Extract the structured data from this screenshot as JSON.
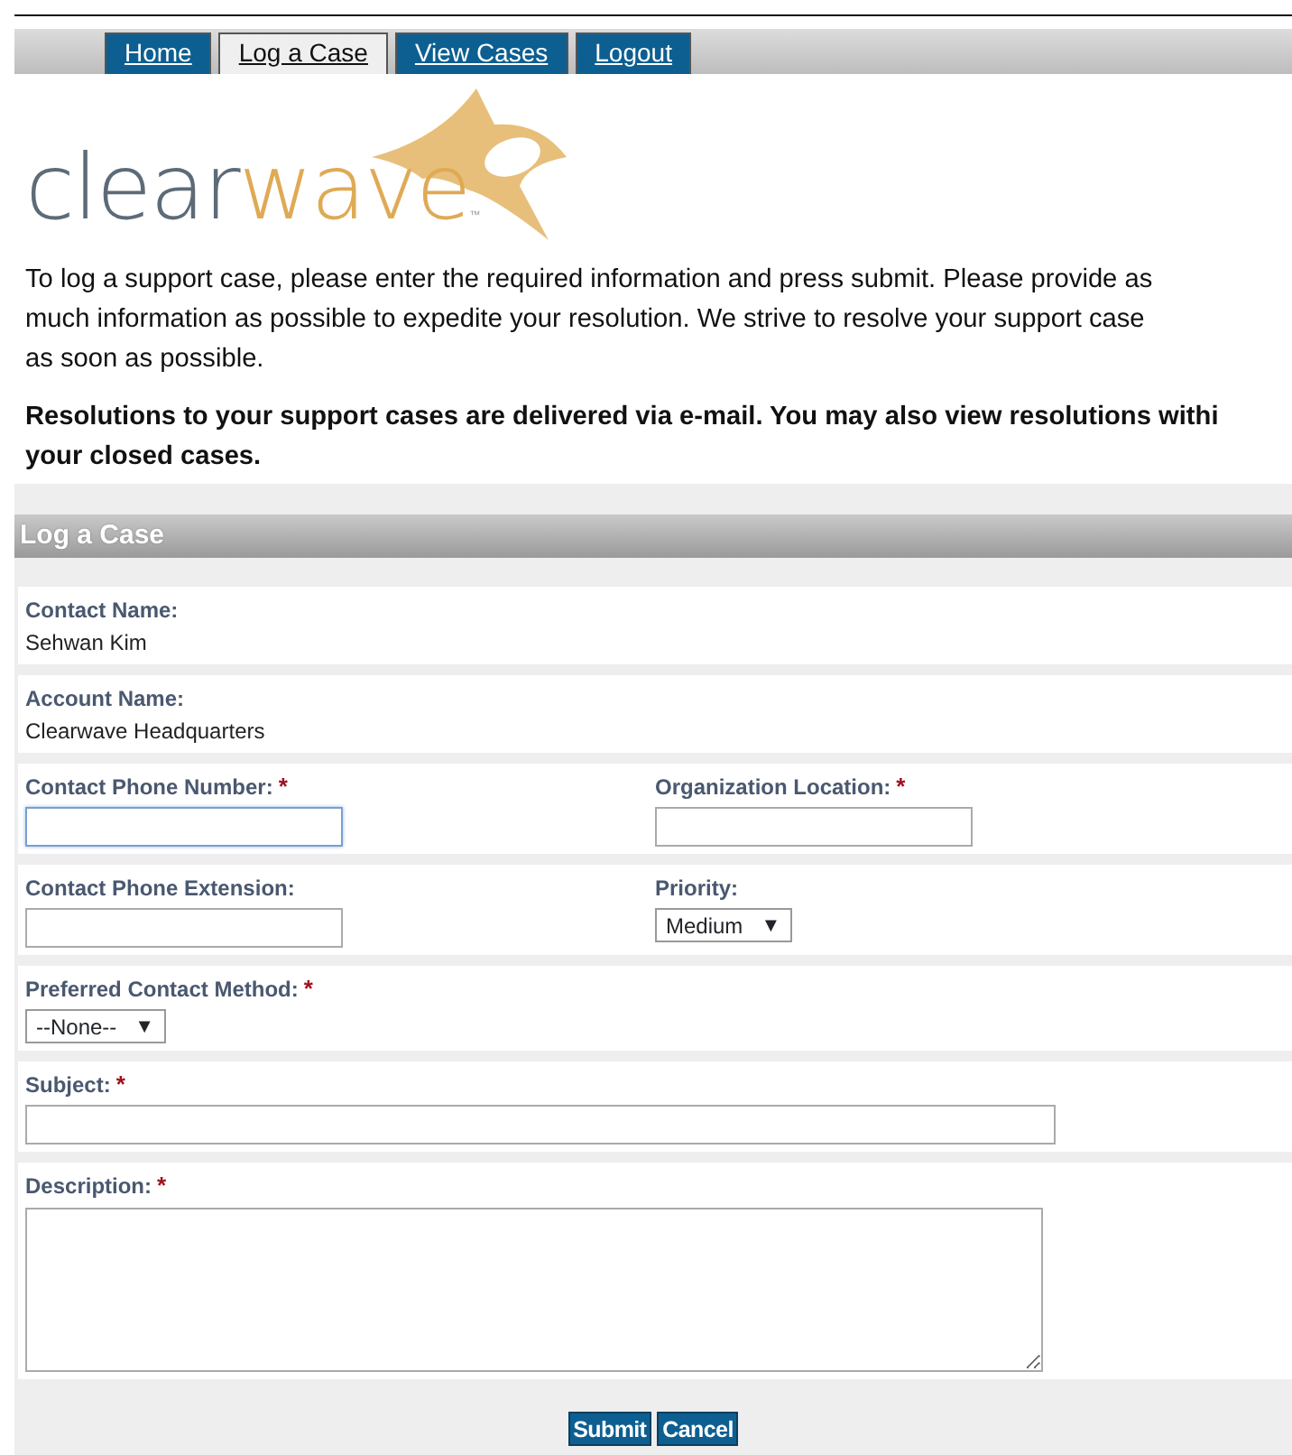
{
  "tabs": [
    {
      "label": "Home",
      "selected": false
    },
    {
      "label": "Log a Case",
      "selected": true
    },
    {
      "label": "View Cases",
      "selected": false
    },
    {
      "label": "Logout",
      "selected": false
    }
  ],
  "logo": {
    "text_dark": "clear",
    "text_accent": "wave",
    "tm": "™"
  },
  "intro": {
    "lines": [
      "To log a support case, please enter the required information and press submit.  Please provide as",
      "much information as possible to expedite your resolution.  We strive to resolve your support case",
      "as soon as possible."
    ]
  },
  "notice": {
    "lines": [
      "Resolutions to your support cases are delivered via e-mail.  You may also view resolutions withi",
      "your closed cases."
    ]
  },
  "section_title": "Log a Case",
  "rows": [
    {
      "fields": [
        {
          "kind": "static",
          "label": "Contact Name:",
          "value": "Sehwan Kim"
        }
      ]
    },
    {
      "fields": [
        {
          "kind": "static",
          "label": "Account Name:",
          "value": "Clearwave Headquarters"
        }
      ]
    },
    {
      "fields": [
        {
          "kind": "text",
          "label": "Contact Phone Number:",
          "required_mark": "*",
          "focused": true
        },
        {
          "kind": "text",
          "label": "Organization Location:",
          "required_mark": "*",
          "focused": false
        }
      ]
    },
    {
      "fields": [
        {
          "kind": "text",
          "label": "Contact Phone Extension:",
          "focused": false
        },
        {
          "kind": "select",
          "label": "Priority:",
          "value": "Medium",
          "caret": "▼"
        }
      ]
    },
    {
      "fields": [
        {
          "kind": "select",
          "label": "Preferred Contact Method:",
          "value": "--None--",
          "caret": "▼",
          "required_mark": "*"
        }
      ]
    },
    {
      "fields": [
        {
          "kind": "wide",
          "label": "Subject:",
          "required_mark": "*",
          "focused": false
        }
      ]
    },
    {
      "fields": [
        {
          "kind": "textarea",
          "label": "Description:",
          "required_mark": "*"
        }
      ]
    }
  ],
  "buttons": [
    "Submit",
    "Cancel"
  ]
}
